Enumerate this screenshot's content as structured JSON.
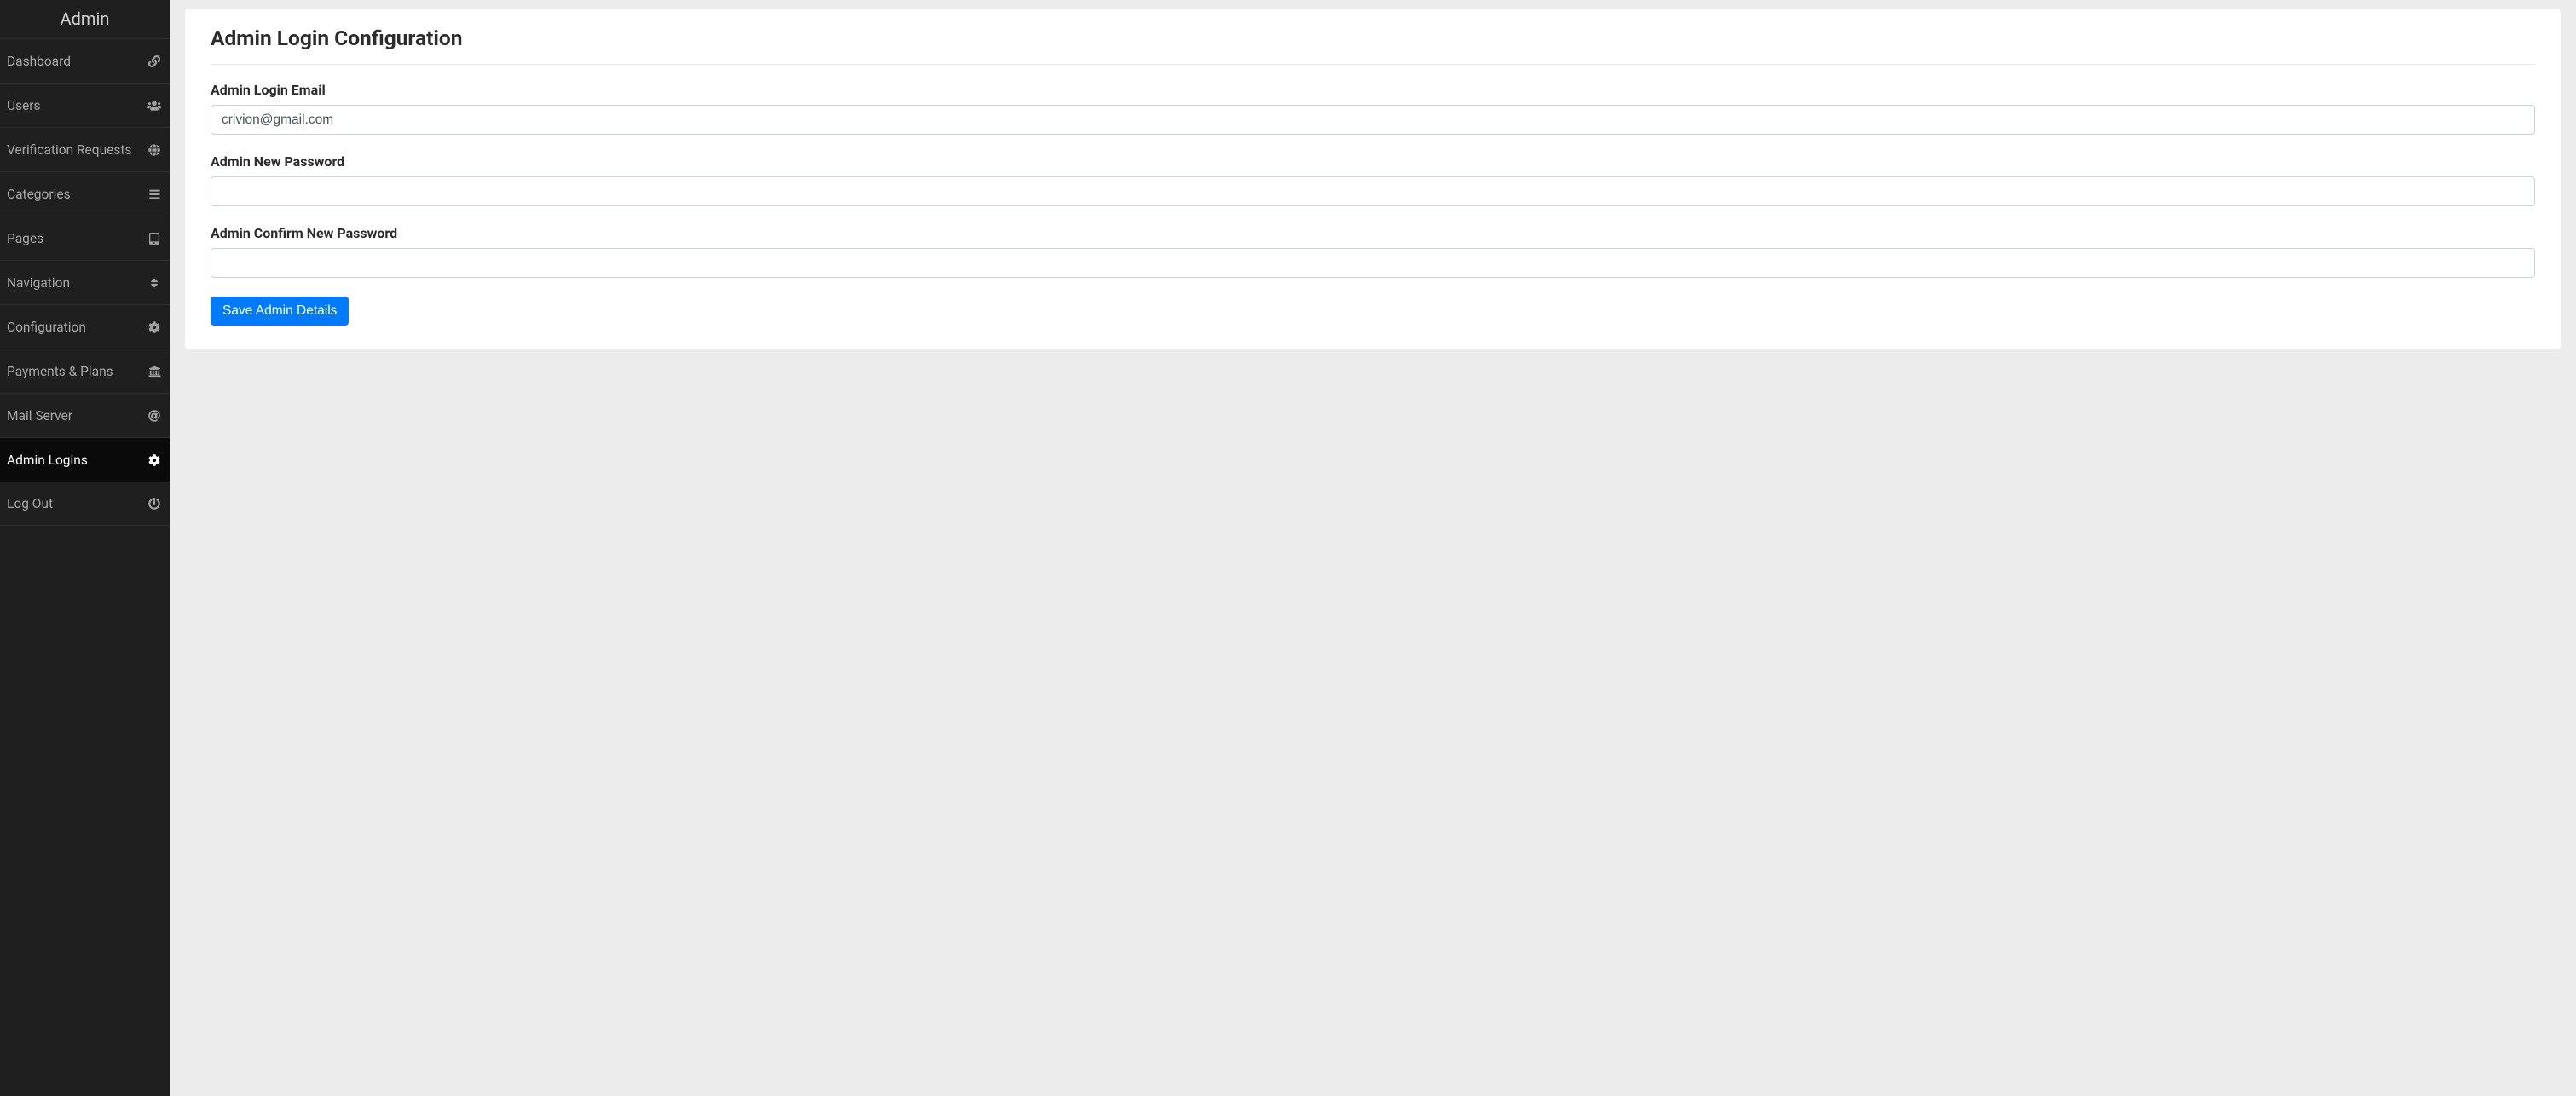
{
  "sidebar": {
    "title": "Admin",
    "items": [
      {
        "label": "Dashboard",
        "icon": "link-icon",
        "active": false
      },
      {
        "label": "Users",
        "icon": "users-icon",
        "active": false
      },
      {
        "label": "Verification Requests",
        "icon": "globe-icon",
        "active": false
      },
      {
        "label": "Categories",
        "icon": "bars-icon",
        "active": false
      },
      {
        "label": "Pages",
        "icon": "tablet-icon",
        "active": false
      },
      {
        "label": "Navigation",
        "icon": "sort-icon",
        "active": false
      },
      {
        "label": "Configuration",
        "icon": "gear-icon",
        "active": false
      },
      {
        "label": "Payments & Plans",
        "icon": "bank-icon",
        "active": false
      },
      {
        "label": "Mail Server",
        "icon": "at-icon",
        "active": false
      },
      {
        "label": "Admin Logins",
        "icon": "gear-icon",
        "active": true
      },
      {
        "label": "Log Out",
        "icon": "power-icon",
        "active": false
      }
    ]
  },
  "main": {
    "title": "Admin Login Configuration",
    "form": {
      "email_label": "Admin Login Email",
      "email_value": "crivion@gmail.com",
      "new_password_label": "Admin New Password",
      "new_password_value": "",
      "confirm_password_label": "Admin Confirm New Password",
      "confirm_password_value": "",
      "submit_label": "Save Admin Details"
    }
  },
  "colors": {
    "primary": "#007bff",
    "sidebar_bg": "#1f1f1f",
    "page_bg": "#ececec"
  }
}
